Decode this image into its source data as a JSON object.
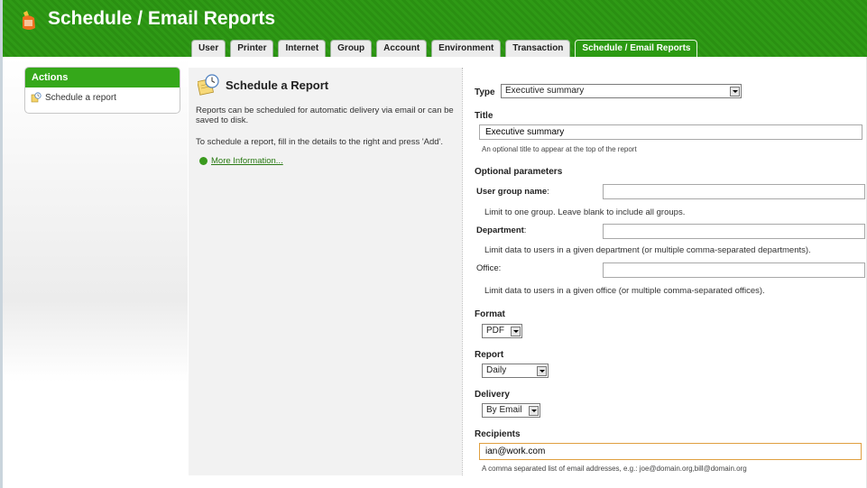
{
  "app": {
    "title": "Schedule / Email Reports"
  },
  "tabs": [
    {
      "label": "User"
    },
    {
      "label": "Printer"
    },
    {
      "label": "Internet"
    },
    {
      "label": "Group"
    },
    {
      "label": "Account"
    },
    {
      "label": "Environment"
    },
    {
      "label": "Transaction"
    },
    {
      "label": "Schedule / Email Reports",
      "active": true
    }
  ],
  "actions": {
    "heading": "Actions",
    "items": [
      {
        "label": "Schedule a report"
      }
    ]
  },
  "intro": {
    "title": "Schedule a Report",
    "p1": "Reports can be scheduled for automatic delivery via email or can be saved to disk.",
    "p2": "To schedule a report, fill in the details to the right and press 'Add'.",
    "more_link": "More Information..."
  },
  "form": {
    "type_label": "Type",
    "type_value": "Executive summary",
    "title_label": "Title",
    "title_value": "Executive summary",
    "title_hint": "An optional title to appear at the top of the report",
    "optional_label": "Optional parameters",
    "user_group_label": "User group name",
    "user_group_hint": "Limit to one group. Leave blank to include all groups.",
    "department_label": "Department",
    "department_hint": "Limit data to users in a given department (or multiple comma-separated departments).",
    "office_label": "Office",
    "office_hint": "Limit data to users in a given office (or multiple comma-separated offices).",
    "format_label": "Format",
    "format_value": "PDF",
    "report_label": "Report",
    "report_value": "Daily",
    "delivery_label": "Delivery",
    "delivery_value": "By Email",
    "recipients_label": "Recipients",
    "recipients_value": "ian@work.com",
    "recipients_hint": "A comma separated list of email addresses, e.g.: joe@domain.org,bill@domain.org"
  },
  "colors": {
    "header_green": "#2f9a16",
    "active_tab": "#2c9a12",
    "link": "#2a7a14"
  }
}
